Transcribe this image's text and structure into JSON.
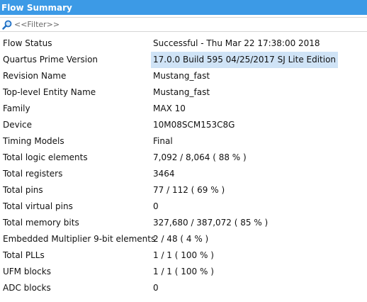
{
  "header": {
    "title": "Flow Summary"
  },
  "filter": {
    "placeholder": "<<Filter>>",
    "value": ""
  },
  "colors": {
    "title_bar": "#3c9ae6",
    "selected_cell": "#cfe3f6"
  },
  "rows": [
    {
      "label": "Flow Status",
      "value": "Successful - Thu Mar 22 17:38:00 2018"
    },
    {
      "label": "Quartus Prime Version",
      "value": "17.0.0 Build 595 04/25/2017 SJ Lite Edition"
    },
    {
      "label": "Revision Name",
      "value": "Mustang_fast"
    },
    {
      "label": "Top-level Entity Name",
      "value": "Mustang_fast"
    },
    {
      "label": "Family",
      "value": "MAX 10"
    },
    {
      "label": "Device",
      "value": "10M08SCM153C8G"
    },
    {
      "label": "Timing Models",
      "value": "Final"
    },
    {
      "label": "Total logic elements",
      "value": "7,092 / 8,064 ( 88 % )"
    },
    {
      "label": "Total registers",
      "value": "3464"
    },
    {
      "label": "Total pins",
      "value": "77 / 112 ( 69 % )"
    },
    {
      "label": "Total virtual pins",
      "value": "0"
    },
    {
      "label": "Total memory bits",
      "value": "327,680 / 387,072 ( 85 % )"
    },
    {
      "label": "Embedded Multiplier 9-bit elements",
      "value": "2 / 48 ( 4 % )"
    },
    {
      "label": "Total PLLs",
      "value": "1 / 1 ( 100 % )"
    },
    {
      "label": "UFM blocks",
      "value": "1 / 1 ( 100 % )"
    },
    {
      "label": "ADC blocks",
      "value": "0"
    }
  ]
}
